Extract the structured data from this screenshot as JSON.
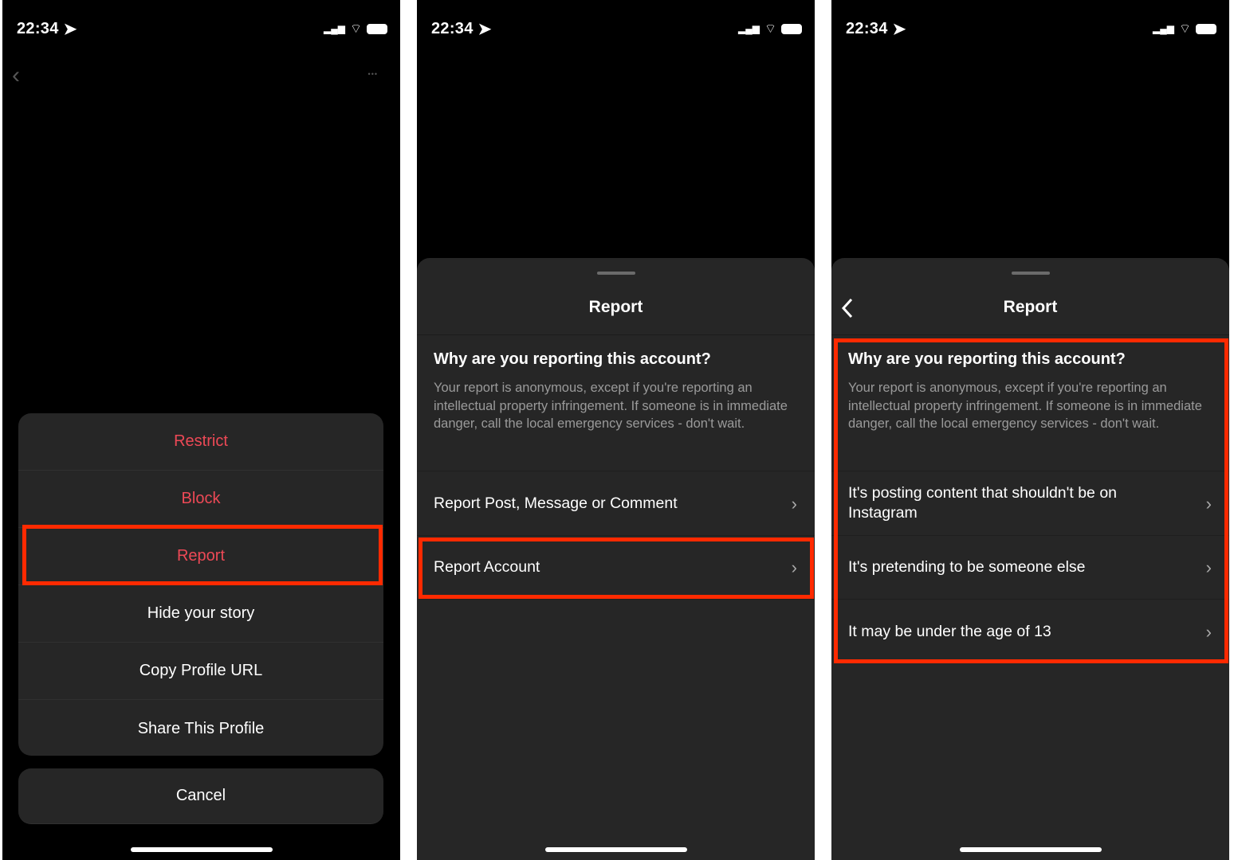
{
  "status": {
    "time": "22:34"
  },
  "panel1": {
    "menu": [
      "Restrict",
      "Block",
      "Report",
      "Hide your story",
      "Copy Profile URL",
      "Share This Profile"
    ],
    "cancel": "Cancel",
    "more": "•••"
  },
  "panel2": {
    "title": "Report",
    "heading": "Why are you reporting this account?",
    "body": "Your report is anonymous, except if you're reporting an intellectual property infringement. If someone is in immediate danger, call the local emergency services - don't wait.",
    "rows": [
      "Report Post, Message or Comment",
      "Report Account"
    ]
  },
  "panel3": {
    "title": "Report",
    "heading": "Why are you reporting this account?",
    "body": "Your report is anonymous, except if you're reporting an intellectual property infringement. If someone is in immediate danger, call the local emergency services - don't wait.",
    "rows": [
      "It's posting content that shouldn't be on Instagram",
      "It's pretending to be someone else",
      "It may be under the age of 13"
    ]
  },
  "colors": {
    "destructive": "#ed4956",
    "highlight": "#ff2a00",
    "sheet": "#262626"
  }
}
